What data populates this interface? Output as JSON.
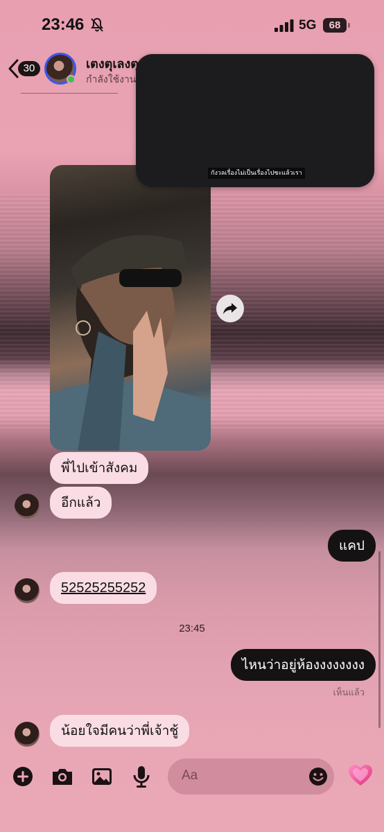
{
  "status_bar": {
    "time": "23:46",
    "network": "5G",
    "battery": "68"
  },
  "header": {
    "back_count": "30",
    "name": "เตงตุเลงตุ",
    "status": "กำลังใช้งาน"
  },
  "overlay": {
    "caption": "กังวลเรื่องไม่เป็นเรื่องไปซะแล้วเรา"
  },
  "messages": [
    {
      "from": "in",
      "text": "พี่ไปเข้าสังคม"
    },
    {
      "from": "in",
      "text": "อีกแล้ว"
    },
    {
      "from": "out",
      "text": "แคป"
    },
    {
      "from": "in",
      "text": "52525255252"
    },
    {
      "from": "out",
      "text": "ไหนว่าอยู่ห้องงงงงงงง"
    },
    {
      "from": "in",
      "text": "น้อยใจมีคนว่าพี่เจ้าชู้"
    }
  ],
  "timestamp": "23:45",
  "seen_label": "เห็นแล้ว",
  "composer": {
    "placeholder": "Aa"
  },
  "colors": {
    "incoming_bubble": "#fadce4",
    "outgoing_bubble": "#151214",
    "online_dot": "#3bc253",
    "avatar_ring": "#3c59e8"
  },
  "icons": [
    "bell-slash-icon",
    "signal-icon",
    "chevron-left-icon",
    "share-icon",
    "plus-icon",
    "camera-icon",
    "gallery-icon",
    "mic-icon",
    "emoji-icon",
    "heart-icon"
  ]
}
